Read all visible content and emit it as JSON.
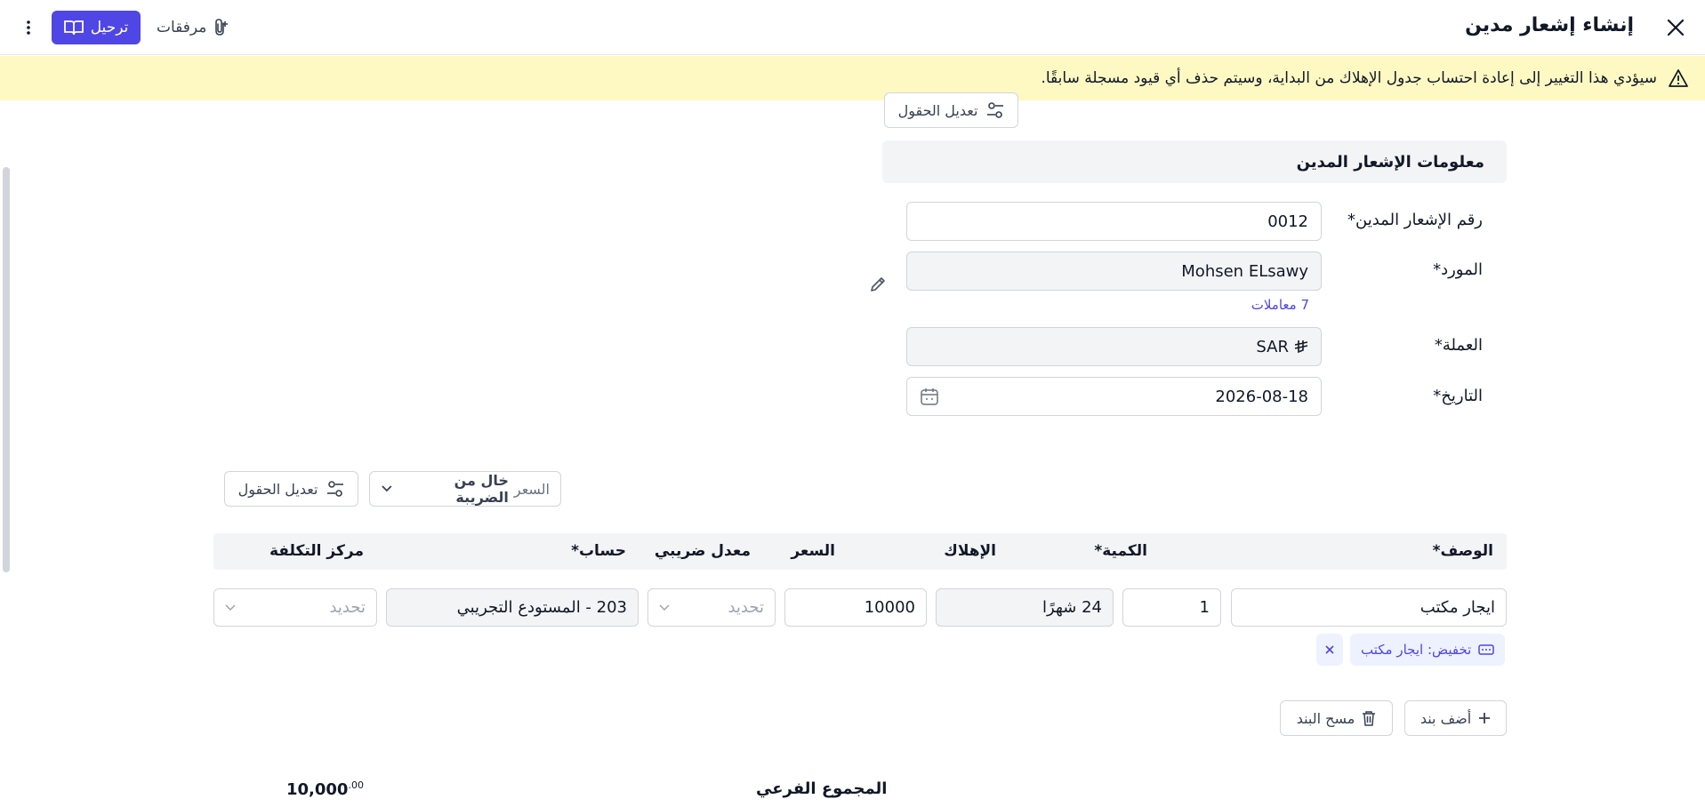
{
  "header": {
    "title": "إنشاء إشعار مدين",
    "post_label": "ترحيل",
    "attachments_label": "مرفقات"
  },
  "banner": {
    "text": "سيؤدي هذا التغيير إلى إعادة احتساب جدول الإهلاك من البداية، وسيتم حذف أي قيود مسجلة سابقًا."
  },
  "edit_fields_label": "تعديل الحقول",
  "form": {
    "section_title": "معلومات الإشعار المدين",
    "number_label": "رقم الإشعار المدين*",
    "number_value": "0012",
    "supplier_label": "المورد*",
    "supplier_value": "Mohsen ELsawy",
    "transactions_link": "7 معاملات",
    "currency_label": "العملة*",
    "currency_value": "SAR",
    "date_label": "التاريخ*",
    "date_value": "2026-08-18"
  },
  "price_mode": {
    "prefix": "السعر",
    "value": "خال من الضريبة"
  },
  "table": {
    "columns": {
      "description": "الوصف*",
      "quantity": "الكمية*",
      "depreciation": "الإهلاك",
      "price": "السعر",
      "tax_rate": "معدل ضريبي",
      "account": "حساب*",
      "cost_center": "مركز التكلفة"
    },
    "row": {
      "description": "ايجار مكتب",
      "quantity": "1",
      "depreciation": "24 شهرًا",
      "price": "10000",
      "tax_rate_placeholder": "تحديد",
      "account": "203 - المستودع التجريبي",
      "cost_center_placeholder": "تحديد"
    },
    "discount_chip": "تخفيض: ايجار مكتب"
  },
  "actions": {
    "add_line": "أضف بند",
    "clear_line": "مسح البند"
  },
  "totals": {
    "subtotal_label": "المجموع الفرعي",
    "subtotal_value": "10,000",
    "subtotal_decimals": ".00"
  },
  "colors": {
    "accent": "#4f46e5",
    "banner_bg": "#fef9c3",
    "readonly_bg": "#f3f4f6"
  }
}
